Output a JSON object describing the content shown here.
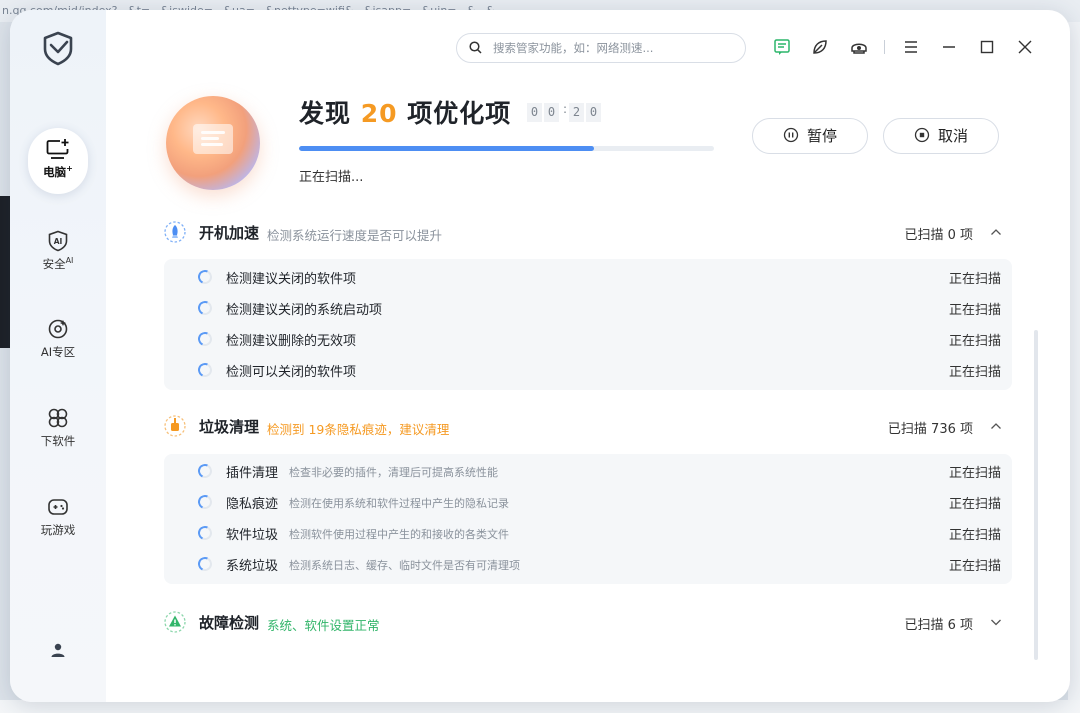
{
  "background": {
    "url_text": "n.qq.com/mid/index?...&t=...&iswide=...&ua=...&nettype=wifi&...&isapp=...&uin=...&...&..."
  },
  "app": {
    "logo": "shield-logo"
  },
  "nav": [
    {
      "label": "电脑",
      "sup": "+",
      "icon": "monitor-plus-icon",
      "active": true
    },
    {
      "label": "安全",
      "sup": "AI",
      "icon": "ai-shield-icon",
      "active": false
    },
    {
      "label": "AI专区",
      "sup": "",
      "icon": "ai-zone-icon",
      "active": false
    },
    {
      "label": "下软件",
      "sup": "",
      "icon": "software-icon",
      "active": false
    },
    {
      "label": "玩游戏",
      "sup": "",
      "icon": "gamepad-icon",
      "active": false
    }
  ],
  "search": {
    "placeholder": "搜索管家功能，如：网络测速..."
  },
  "header": {
    "title_prefix": "发现",
    "title_count": "20",
    "title_suffix": "项优化项",
    "timer": [
      "0",
      "0",
      "2",
      "0"
    ],
    "timer_sep": ":",
    "progress": 0.71,
    "status": "正在扫描..."
  },
  "buttons": {
    "pause": "暂停",
    "cancel": "取消"
  },
  "sections": [
    {
      "name": "开机加速",
      "desc": "检测系统运行速度是否可以提升",
      "count": "已扫描 0 项",
      "items": [
        {
          "title": "检测建议关闭的软件项",
          "desc": "",
          "status": "正在扫描"
        },
        {
          "title": "检测建议关闭的系统启动项",
          "desc": "",
          "status": "正在扫描"
        },
        {
          "title": "检测建议删除的无效项",
          "desc": "",
          "status": "正在扫描"
        },
        {
          "title": "检测可以关闭的软件项",
          "desc": "",
          "status": "正在扫描"
        }
      ]
    },
    {
      "name": "垃圾清理",
      "desc": "检测到 19条隐私痕迹，建议清理",
      "count": "已扫描 736 项",
      "items": [
        {
          "title": "插件清理",
          "desc": "检查非必要的插件，清理后可提高系统性能",
          "status": "正在扫描"
        },
        {
          "title": "隐私痕迹",
          "desc": "检测在使用系统和软件过程中产生的隐私记录",
          "status": "正在扫描"
        },
        {
          "title": "软件垃圾",
          "desc": "检测软件使用过程中产生的和接收的各类文件",
          "status": "正在扫描"
        },
        {
          "title": "系统垃圾",
          "desc": "检测系统日志、缓存、临时文件是否有可清理项",
          "status": "正在扫描"
        }
      ]
    },
    {
      "name": "故障检测",
      "desc": "系统、软件设置正常",
      "count": "已扫描 6 项",
      "items": []
    }
  ],
  "colors": {
    "accent": "#4d8ef3",
    "orange": "#f59a23",
    "green": "#32b56a"
  }
}
